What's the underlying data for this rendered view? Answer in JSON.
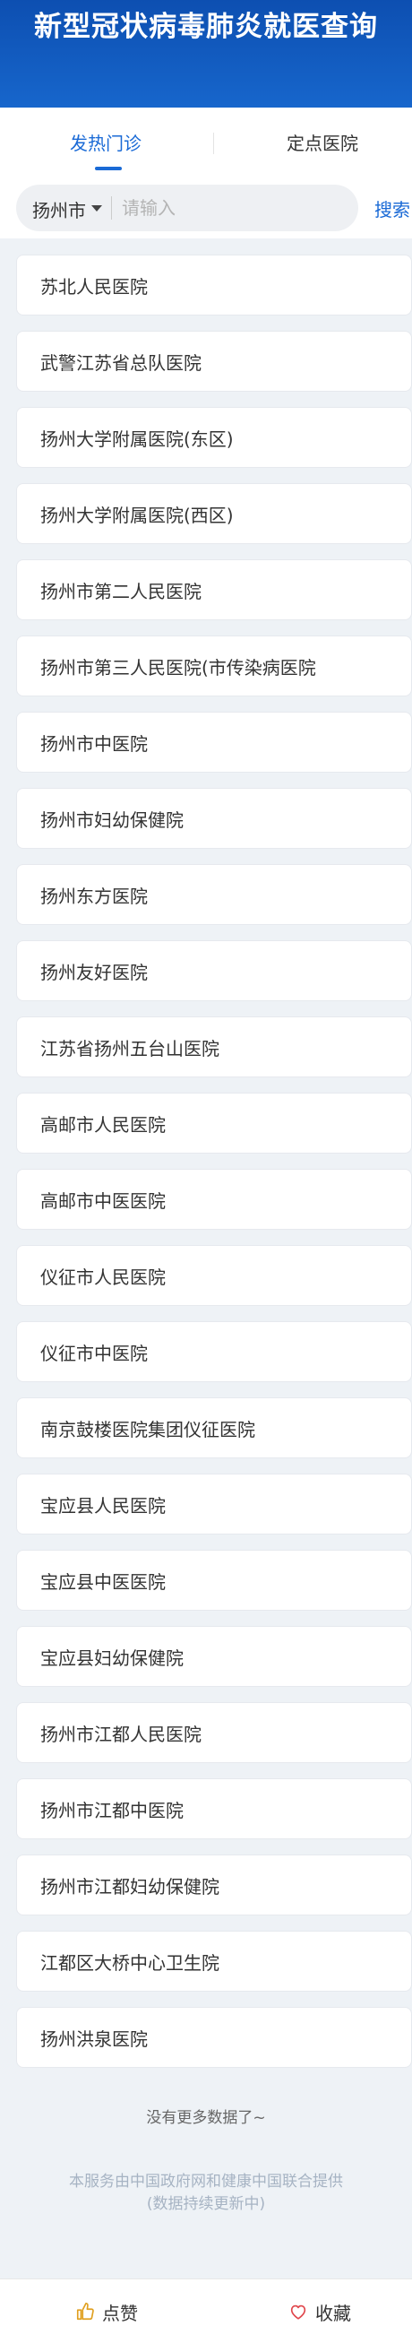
{
  "header": {
    "title": "新型冠状病毒肺炎就医查询"
  },
  "tabs": [
    {
      "label": "发热门诊",
      "active": true
    },
    {
      "label": "定点医院",
      "active": false
    }
  ],
  "search": {
    "city": "扬州市",
    "placeholder": "请输入",
    "value": "",
    "button_label": "搜索"
  },
  "hospitals": [
    "苏北人民医院",
    "武警江苏省总队医院",
    "扬州大学附属医院(东区)",
    "扬州大学附属医院(西区)",
    "扬州市第二人民医院",
    "扬州市第三人民医院(市传染病医院",
    "扬州市中医院",
    "扬州市妇幼保健院",
    "扬州东方医院",
    "扬州友好医院",
    "江苏省扬州五台山医院",
    "高邮市人民医院",
    "高邮市中医医院",
    "仪征市人民医院",
    "仪征市中医院",
    "南京鼓楼医院集团仪征医院",
    "宝应县人民医院",
    "宝应县中医医院",
    "宝应县妇幼保健院",
    "扬州市江都人民医院",
    "扬州市江都中医院",
    "扬州市江都妇幼保健院",
    "江都区大桥中心卫生院",
    "扬州洪泉医院"
  ],
  "list_end_text": "没有更多数据了~",
  "footer": {
    "line1": "本服务由中国政府网和健康中国联合提供",
    "line2": "(数据持续更新中)"
  },
  "bottom_bar": {
    "like_label": "点赞",
    "like_icon": "thumbs-up-icon",
    "favorite_label": "收藏",
    "favorite_icon": "heart-icon"
  },
  "colors": {
    "header_bg": "#1766cc",
    "accent": "#1a6ad6",
    "page_bg": "#eef2f6",
    "heart": "#e0474c"
  }
}
